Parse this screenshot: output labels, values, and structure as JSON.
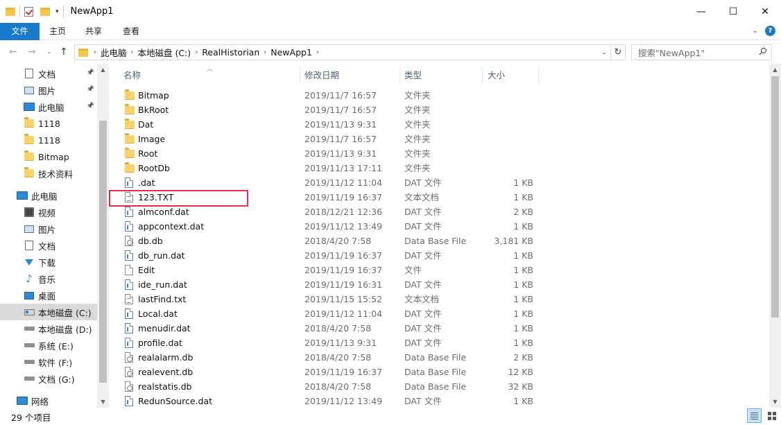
{
  "window": {
    "title": "NewApp1",
    "controls": {
      "minimize": "—",
      "maximize": "☐",
      "close": "✕"
    }
  },
  "ribbon": {
    "tabs": [
      "文件",
      "主页",
      "共享",
      "查看"
    ],
    "help": "?"
  },
  "address": {
    "crumbs": [
      "此电脑",
      "本地磁盘 (C:)",
      "RealHistorian",
      "NewApp1"
    ],
    "search_placeholder": "搜索\"NewApp1\""
  },
  "nav_pane": {
    "quick_access": [
      {
        "label": "文档",
        "icon": "document-icon",
        "pinned": true
      },
      {
        "label": "图片",
        "icon": "picture-icon",
        "pinned": true
      },
      {
        "label": "此电脑",
        "icon": "computer-icon",
        "pinned": true
      },
      {
        "label": "1118",
        "icon": "folder-icon",
        "pinned": false
      },
      {
        "label": "1118",
        "icon": "folder-icon",
        "pinned": false
      },
      {
        "label": "Bitmap",
        "icon": "folder-icon",
        "pinned": false
      },
      {
        "label": "技术资料",
        "icon": "folder-icon",
        "pinned": false
      }
    ],
    "this_pc": {
      "label": "此电脑",
      "items": [
        {
          "label": "视频",
          "icon": "video-icon"
        },
        {
          "label": "图片",
          "icon": "picture-icon"
        },
        {
          "label": "文档",
          "icon": "document-icon"
        },
        {
          "label": "下载",
          "icon": "download-icon"
        },
        {
          "label": "音乐",
          "icon": "music-icon"
        },
        {
          "label": "桌面",
          "icon": "desktop-icon"
        },
        {
          "label": "本地磁盘 (C:)",
          "icon": "drive-c-icon"
        },
        {
          "label": "本地磁盘 (D:)",
          "icon": "drive-icon"
        },
        {
          "label": "系统 (E:)",
          "icon": "drive-icon"
        },
        {
          "label": "软件 (F:)",
          "icon": "drive-icon"
        },
        {
          "label": "文档 (G:)",
          "icon": "drive-icon"
        }
      ]
    },
    "network": "网络",
    "selected_index": 6
  },
  "columns": {
    "name": "名称",
    "date": "修改日期",
    "type": "类型",
    "size": "大小"
  },
  "files": [
    {
      "name": "Bitmap",
      "date": "2019/11/7 16:57",
      "type": "文件夹",
      "size": "",
      "kind": "folder"
    },
    {
      "name": "BkRoot",
      "date": "2019/11/7 16:57",
      "type": "文件夹",
      "size": "",
      "kind": "folder"
    },
    {
      "name": "Dat",
      "date": "2019/11/13 9:31",
      "type": "文件夹",
      "size": "",
      "kind": "folder"
    },
    {
      "name": "Image",
      "date": "2019/11/7 16:57",
      "type": "文件夹",
      "size": "",
      "kind": "folder"
    },
    {
      "name": "Root",
      "date": "2019/11/13 9:31",
      "type": "文件夹",
      "size": "",
      "kind": "folder"
    },
    {
      "name": "RootDb",
      "date": "2019/11/13 17:11",
      "type": "文件夹",
      "size": "",
      "kind": "folder"
    },
    {
      "name": ".dat",
      "date": "2019/11/12 11:04",
      "type": "DAT 文件",
      "size": "1 KB",
      "kind": "dat"
    },
    {
      "name": "123.TXT",
      "date": "2019/11/19 16:37",
      "type": "文本文档",
      "size": "1 KB",
      "kind": "txt",
      "highlighted": true
    },
    {
      "name": "almconf.dat",
      "date": "2018/12/21 12:36",
      "type": "DAT 文件",
      "size": "2 KB",
      "kind": "dat"
    },
    {
      "name": "appcontext.dat",
      "date": "2019/11/12 13:49",
      "type": "DAT 文件",
      "size": "1 KB",
      "kind": "dat"
    },
    {
      "name": "db.db",
      "date": "2018/4/20 7:58",
      "type": "Data Base File",
      "size": "3,181 KB",
      "kind": "db"
    },
    {
      "name": "db_run.dat",
      "date": "2019/11/19 16:37",
      "type": "DAT 文件",
      "size": "1 KB",
      "kind": "dat"
    },
    {
      "name": "Edit",
      "date": "2019/11/19 16:37",
      "type": "文件",
      "size": "1 KB",
      "kind": "file"
    },
    {
      "name": "ide_run.dat",
      "date": "2019/11/19 16:31",
      "type": "DAT 文件",
      "size": "1 KB",
      "kind": "dat"
    },
    {
      "name": "lastFind.txt",
      "date": "2019/11/15 15:52",
      "type": "文本文档",
      "size": "1 KB",
      "kind": "txt"
    },
    {
      "name": "Local.dat",
      "date": "2019/11/12 11:04",
      "type": "DAT 文件",
      "size": "1 KB",
      "kind": "dat"
    },
    {
      "name": "menudir.dat",
      "date": "2018/4/20 7:58",
      "type": "DAT 文件",
      "size": "1 KB",
      "kind": "dat"
    },
    {
      "name": "profile.dat",
      "date": "2019/11/13 9:31",
      "type": "DAT 文件",
      "size": "1 KB",
      "kind": "dat"
    },
    {
      "name": "realalarm.db",
      "date": "2018/4/20 7:58",
      "type": "Data Base File",
      "size": "2 KB",
      "kind": "db"
    },
    {
      "name": "realevent.db",
      "date": "2019/11/19 16:37",
      "type": "Data Base File",
      "size": "12 KB",
      "kind": "db"
    },
    {
      "name": "realstatis.db",
      "date": "2018/4/20 7:58",
      "type": "Data Base File",
      "size": "32 KB",
      "kind": "db"
    },
    {
      "name": "RedunSource.dat",
      "date": "2019/11/12 13:49",
      "type": "DAT 文件",
      "size": "1 KB",
      "kind": "dat"
    }
  ],
  "status": {
    "count": "29 个项目"
  },
  "colors": {
    "accent": "#1979ca",
    "selection": "#cce8ff",
    "highlight_box": "#e0323a"
  }
}
